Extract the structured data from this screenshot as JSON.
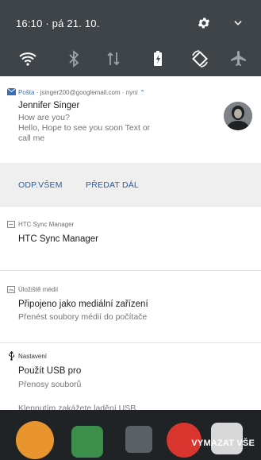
{
  "status_bar": {
    "time_date": "16:10 · pá 21. 10.",
    "icons": [
      "wifi-icon",
      "bluetooth-icon",
      "mobile-data-icon",
      "battery-saver-icon",
      "auto-rotate-icon",
      "airplane-mode-icon"
    ]
  },
  "notifications": {
    "mail": {
      "app": "Pošta",
      "account": " · jsinger200@googlemail.com · nyní",
      "sender": "Jennifer Singer",
      "subject": "How are you?",
      "preview_line1": "Hello,     Hope to see you soon  Text or",
      "preview_line2": "call me",
      "action_reply_all": "ODP.VŠEM",
      "action_forward": "PŘEDAT DÁL"
    },
    "htc_sync": {
      "app": "HTC Sync Manager",
      "title": "HTC Sync Manager"
    },
    "storage": {
      "app": "Úložiště médií",
      "title": "Připojeno jako mediální zařízení",
      "text": "Přenést soubory médií do počítače"
    },
    "settings": {
      "app": "Nastavení",
      "title": "Použít USB pro",
      "text": "Přenosy souborů",
      "clipped_text": "Klepnutím zakážete ladění USB."
    }
  },
  "clear_all_label": "VYMAZAT VŠE",
  "colors": {
    "accent": "#2e5b9a",
    "status_bar_bg": "#3f4448",
    "panel_bg": "#ffffff"
  }
}
